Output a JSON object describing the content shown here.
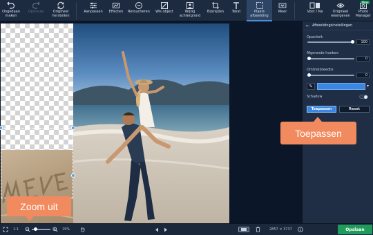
{
  "toolbar": {
    "items": [
      {
        "label": "Ongedaan\nmaken",
        "icon": "undo-icon",
        "enabled": true
      },
      {
        "label": "Opnieuw",
        "icon": "redo-icon",
        "enabled": false
      },
      {
        "label": "Origineel\nherstellen",
        "icon": "restore-icon",
        "enabled": true
      },
      {
        "label": "Aanpassen",
        "icon": "adjust-icon",
        "enabled": true
      },
      {
        "label": "Effecten",
        "icon": "effects-icon",
        "enabled": true
      },
      {
        "label": "Retoucheren",
        "icon": "retouch-icon",
        "enabled": true
      },
      {
        "label": "Wis object",
        "icon": "erase-object-icon",
        "enabled": true
      },
      {
        "label": "Wijzig\nachtergrond",
        "icon": "change-background-icon",
        "enabled": true
      },
      {
        "label": "Bijsnijden",
        "icon": "crop-icon",
        "enabled": true
      },
      {
        "label": "Tekst",
        "icon": "text-icon",
        "enabled": true
      },
      {
        "label": "Plaats\nafbeelding",
        "icon": "place-image-icon",
        "enabled": true,
        "selected": true
      },
      {
        "label": "Meer",
        "icon": "more-icon",
        "enabled": true
      },
      {
        "label": "Voor / Na",
        "icon": "before-after-icon",
        "enabled": true
      },
      {
        "label": "Origineel\nweergeven",
        "icon": "eye-icon",
        "enabled": true
      },
      {
        "label": "Photo\nManager",
        "icon": "photo-manager-icon",
        "enabled": true,
        "badge": "New"
      }
    ]
  },
  "panel": {
    "title": "Afbeeldingsinstellingen",
    "opacity_label": "Opaciteit:",
    "opacity_value": "100",
    "opacity_level": 1.0,
    "corners_label": "Afgeronde hoeken:",
    "corners_value": "0",
    "corners_level": 0,
    "outline_label": "Omtrekbreedte:",
    "outline_value": "0",
    "outline_level": 0,
    "outline_color": "#3b86e0",
    "shadow_label": "Schaduw",
    "apply_label": "Toepassen",
    "reset_label": "Reset"
  },
  "callouts": {
    "apply": "Toepassen",
    "zoom": "Zoom uit"
  },
  "status": {
    "ratio": "1:1",
    "zoom": "19%",
    "dimensions": "2857 × 3737",
    "save_label": "Opslaan"
  },
  "colors": {
    "accent": "#3a86e0",
    "callout": "#f28a5f",
    "save": "#1f9c5a",
    "toolbar_bg": "#1d2b40"
  }
}
